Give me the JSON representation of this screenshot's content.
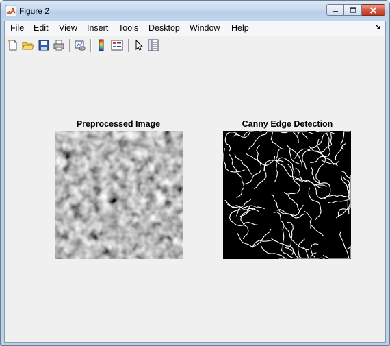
{
  "window": {
    "title": "Figure 2"
  },
  "menu": {
    "items": [
      "File",
      "Edit",
      "View",
      "Insert",
      "Tools",
      "Desktop",
      "Window",
      "Help"
    ]
  },
  "toolbar": {
    "buttons": [
      "new-figure-icon",
      "open-file-icon",
      "save-icon",
      "print-icon",
      "link-plot-icon",
      "insert-colorbar-icon",
      "insert-legend-icon",
      "edit-plot-icon",
      "property-inspector-icon"
    ]
  },
  "axes": [
    {
      "title": "Preprocessed Image"
    },
    {
      "title": "Canny Edge Detection"
    }
  ]
}
